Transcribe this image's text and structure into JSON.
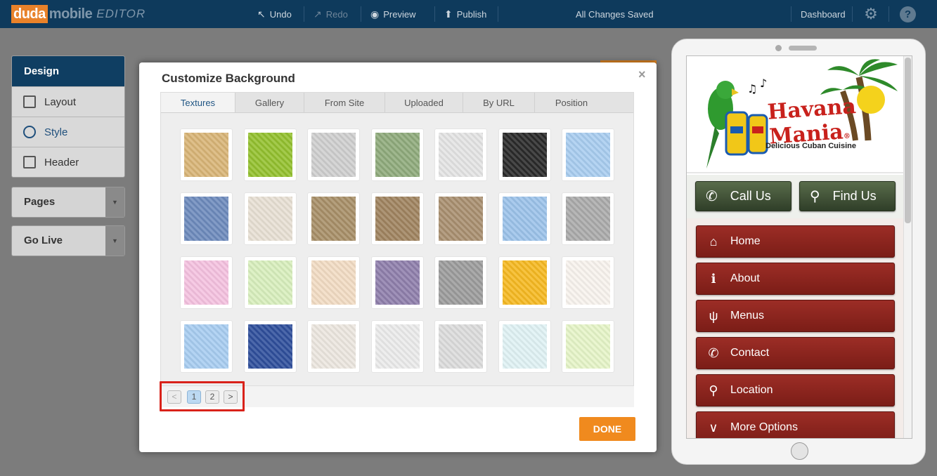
{
  "topbar": {
    "logo_duda": "duda",
    "logo_mobile": "mobile",
    "logo_editor": "EDITOR",
    "undo": "Undo",
    "redo": "Redo",
    "preview": "Preview",
    "publish": "Publish",
    "status": "All Changes Saved",
    "dashboard": "Dashboard",
    "help": "?"
  },
  "sidebar": {
    "design": "Design",
    "items": [
      {
        "label": "Layout",
        "icon": "layout-icon"
      },
      {
        "label": "Style",
        "icon": "palette-icon"
      },
      {
        "label": "Header",
        "icon": "header-icon"
      }
    ],
    "pages": "Pages",
    "go_live": "Go Live"
  },
  "modal": {
    "title": "Customize Background",
    "close": "×",
    "tabs": [
      "Textures",
      "Gallery",
      "From Site",
      "Uploaded",
      "By URL",
      "Position"
    ],
    "active_tab": "Textures",
    "pager": {
      "prev": "<",
      "pages": [
        "1",
        "2"
      ],
      "current": "1",
      "next": ">"
    },
    "done": "DONE",
    "textures": [
      {
        "name": "tan-paper-texture",
        "bg": "#d9b577"
      },
      {
        "name": "green-circles-texture",
        "bg": "#94c12f"
      },
      {
        "name": "gray-stripes-texture",
        "bg": "#cfcfcf"
      },
      {
        "name": "green-diagonal-texture",
        "bg": "#8fab7c"
      },
      {
        "name": "white-geometric-texture",
        "bg": "#e4e4e4"
      },
      {
        "name": "black-brick-texture",
        "bg": "#2a2a2a"
      },
      {
        "name": "blue-sky-texture",
        "bg": "#a9cdf0"
      },
      {
        "name": "blue-denim-texture",
        "bg": "#6e8bbd"
      },
      {
        "name": "beige-lattice-texture",
        "bg": "#e8e0d4"
      },
      {
        "name": "brown-diagonal-texture",
        "bg": "#a88f68"
      },
      {
        "name": "brown-stripes-texture",
        "bg": "#a08460"
      },
      {
        "name": "brown-horizontal-texture",
        "bg": "#a98f70"
      },
      {
        "name": "light-blue-tile-texture",
        "bg": "#9cc3ea"
      },
      {
        "name": "gray-horizontal-texture",
        "bg": "#ababab"
      },
      {
        "name": "pink-texture",
        "bg": "#f5c2e0"
      },
      {
        "name": "light-green-curves-texture",
        "bg": "#d8efbd"
      },
      {
        "name": "peach-diamond-texture",
        "bg": "#f2dcc4"
      },
      {
        "name": "purple-diagonal-texture",
        "bg": "#8f7fac"
      },
      {
        "name": "gray-vertical-texture",
        "bg": "#9c9c9c"
      },
      {
        "name": "yellow-cross-texture",
        "bg": "#f6b922"
      },
      {
        "name": "orange-dash-texture",
        "bg": "#f8f3ee"
      },
      {
        "name": "blue-triangle-texture",
        "bg": "#a8cdf1"
      },
      {
        "name": "navy-denim-texture",
        "bg": "#2f4f9c"
      },
      {
        "name": "diagonal-band-texture",
        "bg": "#ece7df"
      },
      {
        "name": "white-lattice-texture",
        "bg": "#ebebeb"
      },
      {
        "name": "gray-triangle-texture",
        "bg": "#dcdcdc"
      },
      {
        "name": "aqua-lattice-texture",
        "bg": "#e0f2f4"
      },
      {
        "name": "green-leaf-texture",
        "bg": "#e6f5c8"
      }
    ]
  },
  "preview": {
    "logo_title": "Havana Mania",
    "logo_trademark": "®",
    "logo_subtitle": "Delicious Cuban Cuisine",
    "call_us": "Call Us",
    "find_us": "Find Us",
    "menu": [
      {
        "label": "Home",
        "icon": "home-icon",
        "glyph": "⌂"
      },
      {
        "label": "About",
        "icon": "info-icon",
        "glyph": "ℹ"
      },
      {
        "label": "Menus",
        "icon": "fork-knife-icon",
        "glyph": "ψ"
      },
      {
        "label": "Contact",
        "icon": "phone-icon",
        "glyph": "✆"
      },
      {
        "label": "Location",
        "icon": "map-pin-icon",
        "glyph": "⚲"
      },
      {
        "label": "More Options",
        "icon": "chevron-down-icon",
        "glyph": "∨"
      }
    ],
    "colors": {
      "menu_button": "#8b241e",
      "cta_button": "#3e5032"
    }
  }
}
